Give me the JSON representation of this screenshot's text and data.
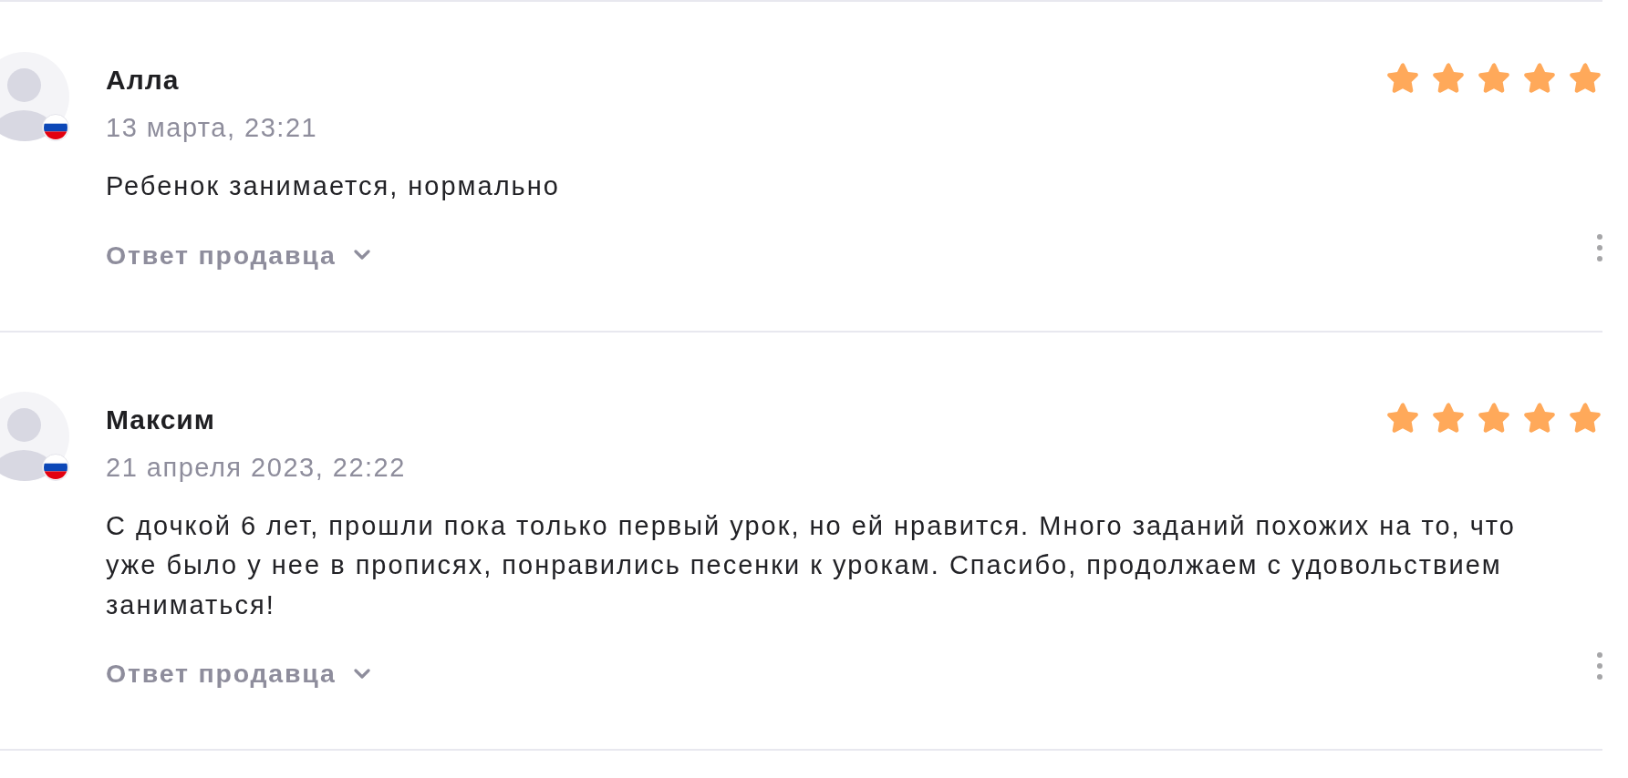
{
  "reviews": [
    {
      "author": "Алла",
      "date": "13 марта, 23:21",
      "stars": 5,
      "text": "Ребенок занимается, нормально",
      "seller_reply": {
        "label": "Ответ продавца",
        "expanded": false
      }
    },
    {
      "author": "Максим",
      "date": "21 апреля 2023, 22:22",
      "stars": 5,
      "text": "С дочкой 6 лет, прошли пока только первый урок, но ей нравится. Много заданий похожих на то, что уже было у нее в прописях, понравились песенки к урокам. Спасибо, продолжаем с удовольствием заниматься!",
      "seller_reply": {
        "label": "Ответ продавца",
        "expanded": false
      }
    }
  ]
}
